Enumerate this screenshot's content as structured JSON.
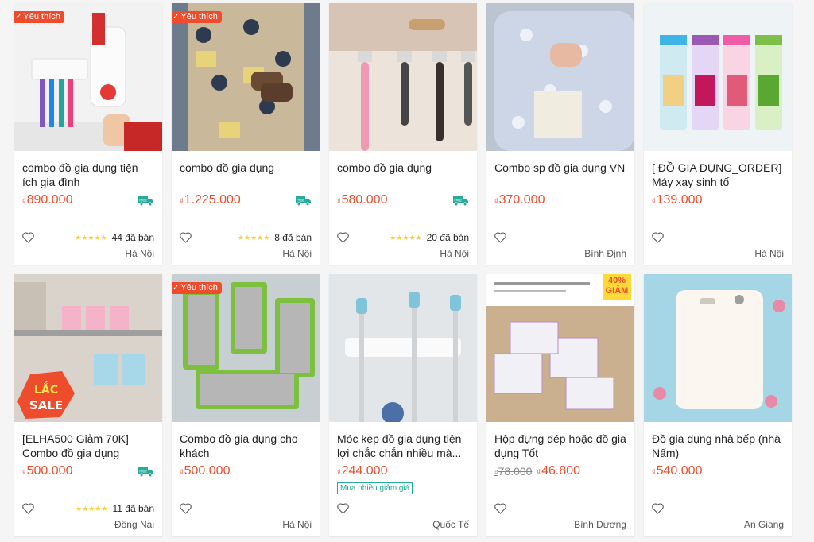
{
  "badges": {
    "favorite": "Yêu thích",
    "discount": "40%\nGIẢM",
    "free_ship": "Free"
  },
  "currency": "₫",
  "colors": {
    "accent": "#ee4d2d",
    "free_ship": "#26aa99",
    "star": "#ffce3d"
  },
  "products": [
    {
      "name": "combo đồ gia dụng tiện ích gia đình",
      "price": "890.000",
      "old_price": "",
      "favorite": true,
      "discount": false,
      "free_ship": true,
      "rating": 5,
      "sold": "44 đã bán",
      "promo": "",
      "location": "Hà Nội",
      "image": "toothbrush-holder"
    },
    {
      "name": "combo đồ gia dụng",
      "price": "1.225.000",
      "old_price": "",
      "favorite": true,
      "discount": false,
      "free_ship": true,
      "rating": 5,
      "sold": "8 đã bán",
      "promo": "",
      "location": "Hà Nội",
      "image": "mickey-mat"
    },
    {
      "name": "combo đồ gia dụng",
      "price": "580.000",
      "old_price": "",
      "favorite": false,
      "discount": false,
      "free_ship": true,
      "rating": 4.5,
      "sold": "20 đã bán",
      "promo": "",
      "location": "Hà Nội",
      "image": "wall-hooks"
    },
    {
      "name": "Combo sp đồ gia dụng VN",
      "price": "370.000",
      "old_price": "",
      "favorite": false,
      "discount": false,
      "free_ship": false,
      "rating": 0,
      "sold": "",
      "promo": "",
      "location": "Bình Định",
      "image": "pillow"
    },
    {
      "name": "[ ĐỒ GIA DỤNG_ORDER] Máy xay sinh tố",
      "price": "139.000",
      "old_price": "",
      "favorite": false,
      "discount": false,
      "free_ship": false,
      "rating": 0,
      "sold": "",
      "promo": "",
      "location": "Hà Nội",
      "image": "blenders"
    },
    {
      "name": "[ELHA500 Giảm 70K] Combo đồ gia dụng",
      "price": "500.000",
      "old_price": "",
      "favorite": false,
      "discount": false,
      "free_ship": true,
      "rating": 5,
      "sold": "11 đã bán",
      "promo": "",
      "location": "Đồng Nai",
      "image": "store-shelf"
    },
    {
      "name": "Combo đồ gia dụng cho khách",
      "price": "500.000",
      "old_price": "",
      "favorite": true,
      "discount": false,
      "free_ship": false,
      "rating": 0,
      "sold": "",
      "promo": "",
      "location": "Hà Nội",
      "image": "chopsticks"
    },
    {
      "name": "Móc kẹp đồ gia dụng tiện lợi chắc chắn nhiều mà...",
      "price": "244.000",
      "old_price": "",
      "favorite": false,
      "discount": false,
      "free_ship": false,
      "rating": 0,
      "sold": "",
      "promo": "Mua nhiều giảm giá",
      "location": "Quốc Tế",
      "image": "mop-holder"
    },
    {
      "name": "Hộp đựng dép hoặc đồ gia dụng Tốt",
      "price": "46.800",
      "old_price": "78.000",
      "favorite": false,
      "discount": true,
      "free_ship": false,
      "rating": 0,
      "sold": "",
      "promo": "",
      "location": "Bình Dương",
      "image": "shoe-boxes"
    },
    {
      "name": "Đồ gia dụng nhà bếp (nhà Nấm)",
      "price": "540.000",
      "old_price": "",
      "favorite": false,
      "discount": false,
      "free_ship": false,
      "rating": 0,
      "sold": "",
      "promo": "",
      "location": "An Giang",
      "image": "cutting-board"
    }
  ]
}
